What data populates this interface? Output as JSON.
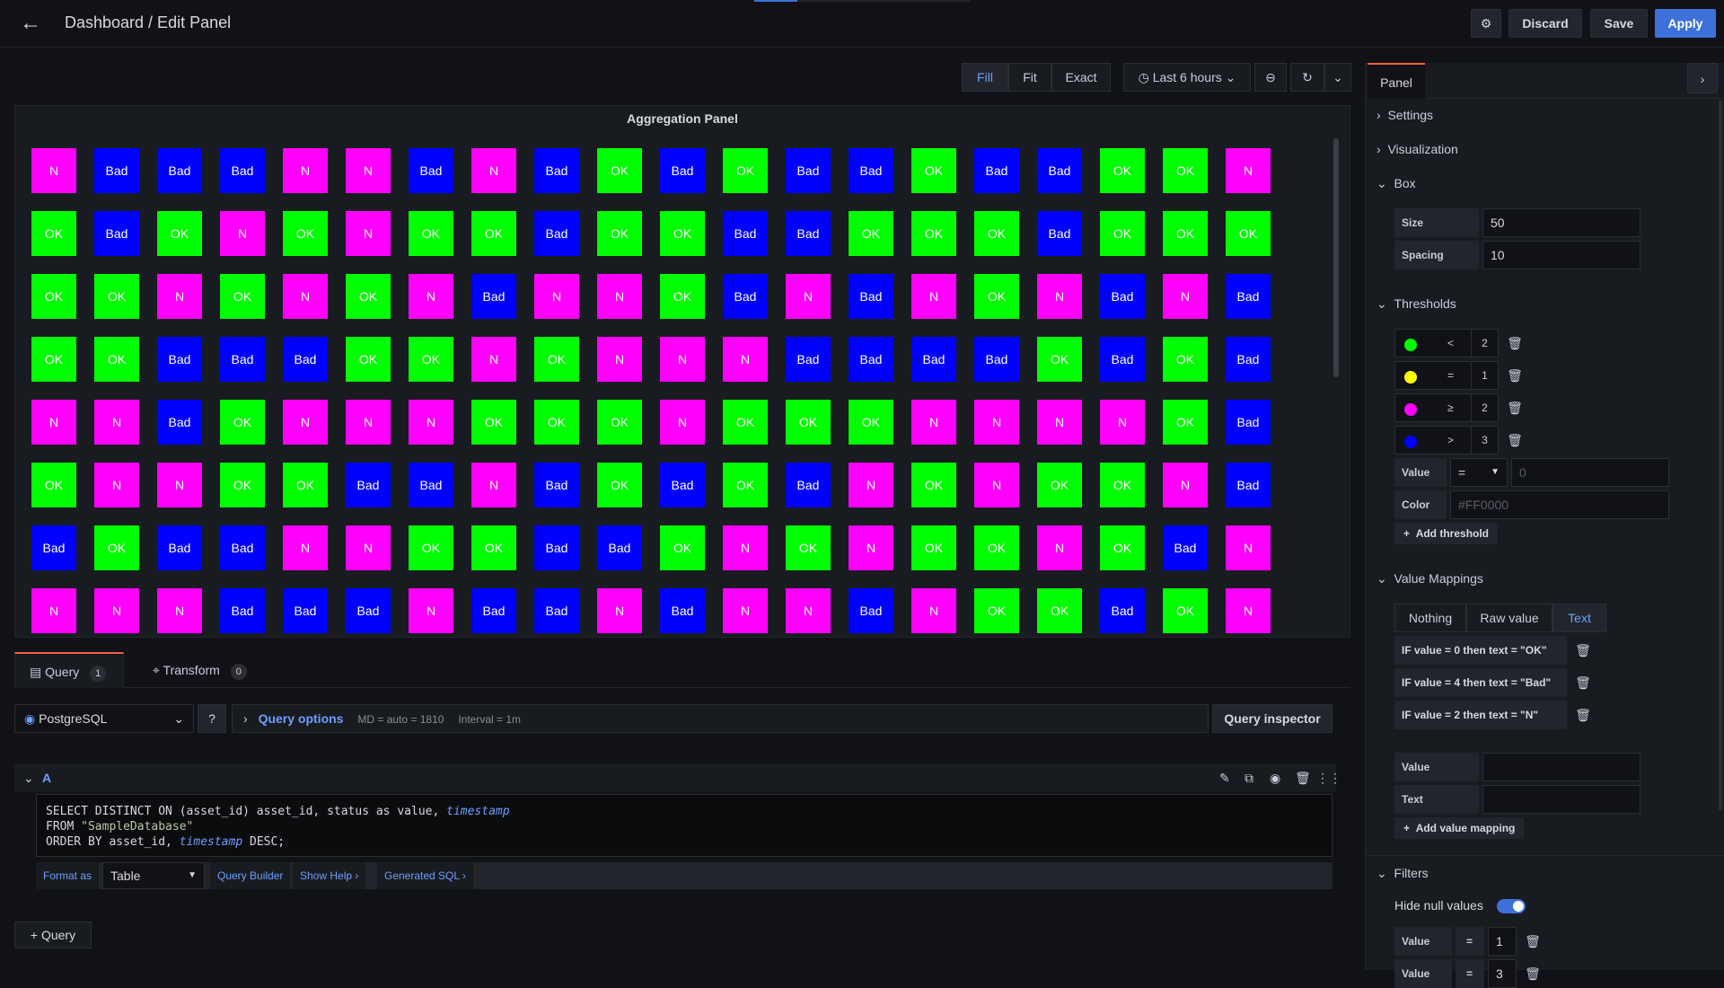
{
  "header": {
    "title": "Dashboard / Edit Panel",
    "discard": "Discard",
    "save": "Save",
    "apply": "Apply"
  },
  "viewbar": {
    "fill": "Fill",
    "fit": "Fit",
    "exact": "Exact",
    "time": "Last 6 hours"
  },
  "panel": {
    "title": "Aggregation Panel",
    "grid": [
      [
        "N",
        "Bad",
        "Bad",
        "Bad",
        "N",
        "N",
        "Bad",
        "N",
        "Bad",
        "OK",
        "Bad",
        "OK",
        "Bad",
        "Bad",
        "OK",
        "Bad",
        "Bad",
        "OK",
        "OK",
        "N"
      ],
      [
        "OK",
        "Bad",
        "OK",
        "N",
        "OK",
        "N",
        "OK",
        "OK",
        "Bad",
        "OK",
        "OK",
        "Bad",
        "Bad",
        "OK",
        "OK",
        "OK",
        "Bad",
        "OK",
        "OK",
        "OK"
      ],
      [
        "OK",
        "OK",
        "N",
        "OK",
        "N",
        "OK",
        "N",
        "Bad",
        "N",
        "N",
        "OK",
        "Bad",
        "N",
        "Bad",
        "N",
        "OK",
        "N",
        "Bad",
        "N",
        "Bad"
      ],
      [
        "OK",
        "OK",
        "Bad",
        "Bad",
        "Bad",
        "OK",
        "OK",
        "N",
        "OK",
        "N",
        "N",
        "N",
        "Bad",
        "Bad",
        "Bad",
        "Bad",
        "OK",
        "Bad",
        "OK",
        "Bad"
      ],
      [
        "N",
        "N",
        "Bad",
        "OK",
        "N",
        "N",
        "N",
        "OK",
        "OK",
        "OK",
        "N",
        "OK",
        "OK",
        "OK",
        "N",
        "N",
        "N",
        "N",
        "OK",
        "Bad"
      ],
      [
        "OK",
        "N",
        "N",
        "OK",
        "OK",
        "Bad",
        "Bad",
        "N",
        "Bad",
        "OK",
        "Bad",
        "OK",
        "Bad",
        "N",
        "OK",
        "N",
        "OK",
        "OK",
        "N",
        "Bad"
      ],
      [
        "Bad",
        "OK",
        "Bad",
        "Bad",
        "N",
        "N",
        "OK",
        "OK",
        "Bad",
        "Bad",
        "OK",
        "N",
        "OK",
        "N",
        "OK",
        "OK",
        "N",
        "OK",
        "Bad",
        "N"
      ],
      [
        "N",
        "N",
        "N",
        "Bad",
        "Bad",
        "Bad",
        "N",
        "Bad",
        "Bad",
        "N",
        "Bad",
        "N",
        "N",
        "Bad",
        "N",
        "OK",
        "OK",
        "Bad",
        "OK",
        "N"
      ]
    ],
    "colors": {
      "OK": "#00ff00",
      "Bad": "#0000ff",
      "N": "#ff00ff"
    }
  },
  "tabs": {
    "query": "Query",
    "query_count": "1",
    "transform": "Transform",
    "transform_count": "0"
  },
  "query": {
    "datasource": "PostgreSQL",
    "options": "Query options",
    "md": "MD = auto = 1810",
    "interval": "Interval = 1m",
    "inspector": "Query inspector",
    "ref": "A",
    "sql_l1a": "SELECT DISTINCT ON (asset_id) asset_id, status as value, ",
    "sql_l1b": "timestamp",
    "sql_l2a": "FROM ",
    "sql_l2b": "\"SampleDatabase\"",
    "sql_l3a": "ORDER BY asset_id, ",
    "sql_l3b": "timestamp",
    "sql_l3c": " DESC;",
    "format_as": "Format as",
    "format_value": "Table",
    "builder": "Query Builder",
    "help": "Show Help",
    "generated": "Generated SQL",
    "add_query": "Query"
  },
  "sidebar": {
    "tab": "Panel",
    "settings": "Settings",
    "visualization": "Visualization",
    "box": "Box",
    "size_label": "Size",
    "size": "50",
    "spacing_label": "Spacing",
    "spacing": "10",
    "thresholds": "Thresholds",
    "th": [
      {
        "color": "#00ff00",
        "op": "<",
        "val": "2"
      },
      {
        "color": "#ffff00",
        "op": "=",
        "val": "1"
      },
      {
        "color": "#ff00ff",
        "op": "≥",
        "val": "2"
      },
      {
        "color": "#0000ff",
        "op": ">",
        "val": "3"
      }
    ],
    "value_label": "Value",
    "value_op": "=",
    "value_placeholder": "0",
    "color_label": "Color",
    "color_placeholder": "#FF0000",
    "add_threshold": "Add threshold",
    "mappings": "Value Mappings",
    "m_nothing": "Nothing",
    "m_raw": "Raw value",
    "m_text": "Text",
    "maps": [
      "IF value = 0 then text = \"OK\"",
      "IF value = 4 then text = \"Bad\"",
      "IF value = 2 then text = \"N\""
    ],
    "map_value": "Value",
    "map_text": "Text",
    "add_mapping": "Add value mapping",
    "filters": "Filters",
    "hide_null": "Hide null values",
    "f": [
      {
        "label": "Value",
        "op": "=",
        "val": "1"
      },
      {
        "label": "Value",
        "op": "=",
        "val": "3"
      }
    ]
  }
}
